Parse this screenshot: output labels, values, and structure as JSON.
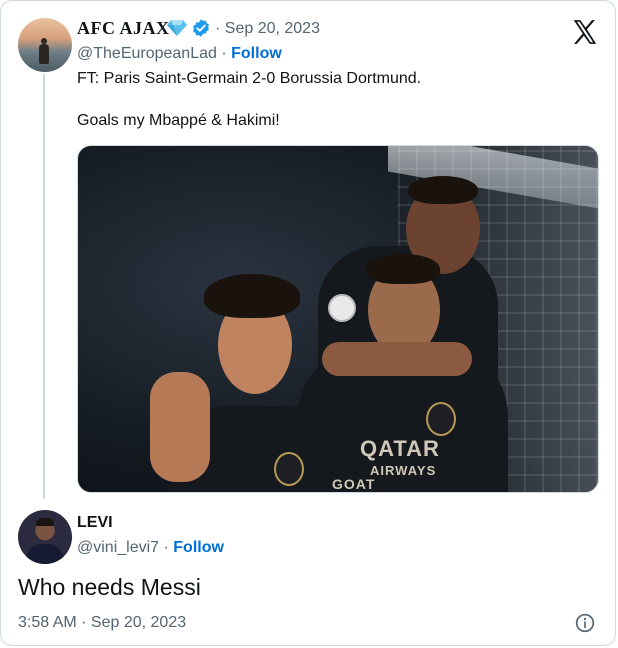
{
  "tweet": {
    "author_name": "AFC AJAX",
    "separator_date": "· Sep 20, 2023",
    "handle": "@TheEuropeanLad",
    "handle_separator": " · ",
    "follow_label": "Follow",
    "text_line1": "FT: Paris Saint-Germain 2-0 Borussia Dortmund.",
    "text_line2": "Goals my Mbappé & Hakimi!",
    "image": {
      "sponsor_line1": "QATAR",
      "sponsor_line2": "AIRWAYS",
      "shirt_print": "GOAT"
    }
  },
  "reply": {
    "author_name": "LEVI",
    "handle": "@vini_levi7",
    "handle_separator": " · ",
    "follow_label": "Follow",
    "text": "Who needs Messi",
    "timestamp": "3:58 AM · Sep 20, 2023"
  },
  "icons": {
    "diamond": "diamond-icon",
    "verified": "verified-badge-icon",
    "x_logo": "x-logo-icon",
    "info": "info-icon"
  },
  "colors": {
    "link": "#006fd6",
    "secondary_text": "#536471",
    "verified": "#1d9bf0",
    "diamond": "#5bc0eb"
  }
}
